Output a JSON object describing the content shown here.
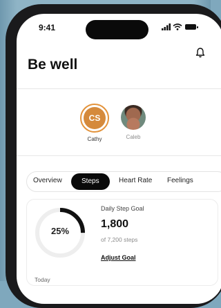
{
  "status_bar": {
    "time": "9:41"
  },
  "header": {
    "title": "Be well"
  },
  "people": [
    {
      "initials": "CS",
      "name": "Cathy",
      "selected": true
    },
    {
      "initials": "",
      "name": "Caleb",
      "selected": false
    }
  ],
  "tabs": [
    {
      "label": "Overview",
      "active": false
    },
    {
      "label": "Steps",
      "active": true
    },
    {
      "label": "Heart Rate",
      "active": false
    },
    {
      "label": "Feelings",
      "active": false
    }
  ],
  "steps_card": {
    "progress_percent_label": "25%",
    "progress_fraction": 0.25,
    "goal_label": "Daily Step Goal",
    "goal_value": "1,800",
    "goal_sub": "of 7,200 steps",
    "adjust_label": "Adjust Goal"
  },
  "section": {
    "today_label": "Today"
  },
  "colors": {
    "accent": "#d58a3c",
    "active_tab": "#0a0a0a",
    "ring": "#111111",
    "ring_track": "#eeeeee"
  },
  "icons": [
    "bell-icon",
    "signal-icon",
    "wifi-icon",
    "battery-icon"
  ]
}
